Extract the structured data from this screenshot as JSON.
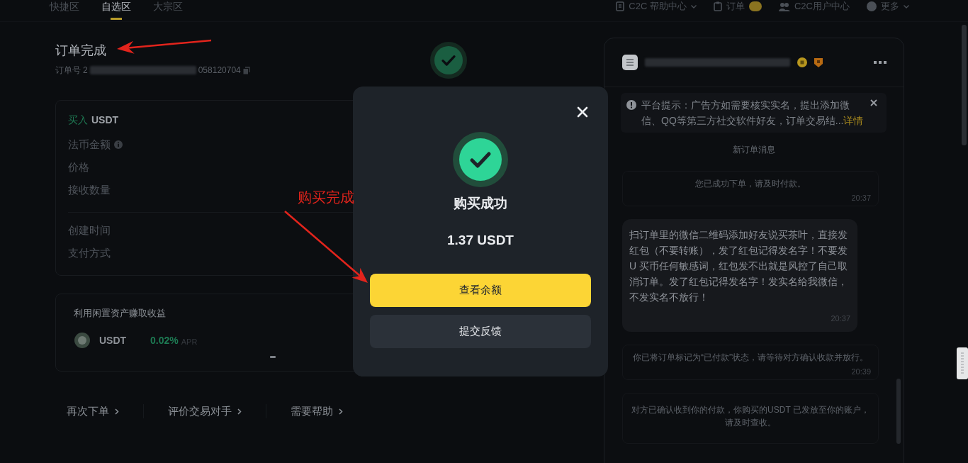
{
  "top_nav": {
    "tabs": [
      {
        "label": "快捷区",
        "selected": false
      },
      {
        "label": "自选区",
        "selected": true
      },
      {
        "label": "大宗区",
        "selected": false
      }
    ],
    "links": [
      {
        "label": "C2C 帮助中心",
        "kind": "dropdown"
      },
      {
        "label": "订单",
        "kind": "badge"
      },
      {
        "label": "C2C用户中心",
        "kind": "plain"
      },
      {
        "label": "更多",
        "kind": "dropdown"
      }
    ]
  },
  "order": {
    "title": "订单完成",
    "number_label": "订单号",
    "number_start": "2",
    "number_end": "058120704"
  },
  "summary": {
    "side": "买入",
    "asset": "USDT",
    "rows": [
      {
        "label": "法币金额",
        "info": true
      },
      {
        "label": "价格",
        "info": false
      },
      {
        "label": "接收数量",
        "info": false
      }
    ],
    "meta_rows": [
      "创建时间",
      "支付方式"
    ]
  },
  "earn": {
    "title": "利用闲置资产赚取收益",
    "asset": "USDT",
    "rate": "0.02%",
    "rate_unit": "APR"
  },
  "actions": [
    "再次下单",
    "评价交易对手",
    "需要帮助"
  ],
  "chat": {
    "notice": {
      "text": "平台提示：广告方如需要核实实名，提出添加微信、QQ等第三方社交软件好友，订单交易结...",
      "link": "详情"
    },
    "divider_label": "新订单消息",
    "messages": [
      {
        "kind": "system",
        "text": "您已成功下单，请及时付款。",
        "time": "20:37"
      },
      {
        "kind": "bubble",
        "text": "扫订单里的微信二维码添加好友说买茶叶，直接发红包（不要转账），发了红包记得发名字！不要发U 买币任何敏感词，红包发不出就是风控了自己取消订单。发了红包记得发名字！发实名给我微信，不发实名不放行！",
        "time": "20:37"
      },
      {
        "kind": "system",
        "text": "你已将订单标记为“已付款”状态，请等待对方确认收款并放行。",
        "time": "20:39"
      },
      {
        "kind": "system",
        "text": "对方已确认收到你的付款，你购买的USDT 已发放至你的账户，请及时查收。"
      }
    ]
  },
  "modal": {
    "title": "购买成功",
    "amount": "1.37 USDT",
    "buttons": [
      {
        "label": "查看余额",
        "kind": "primary"
      },
      {
        "label": "提交反馈",
        "kind": "secondary"
      }
    ]
  },
  "annotation": {
    "label": "购买完成"
  }
}
